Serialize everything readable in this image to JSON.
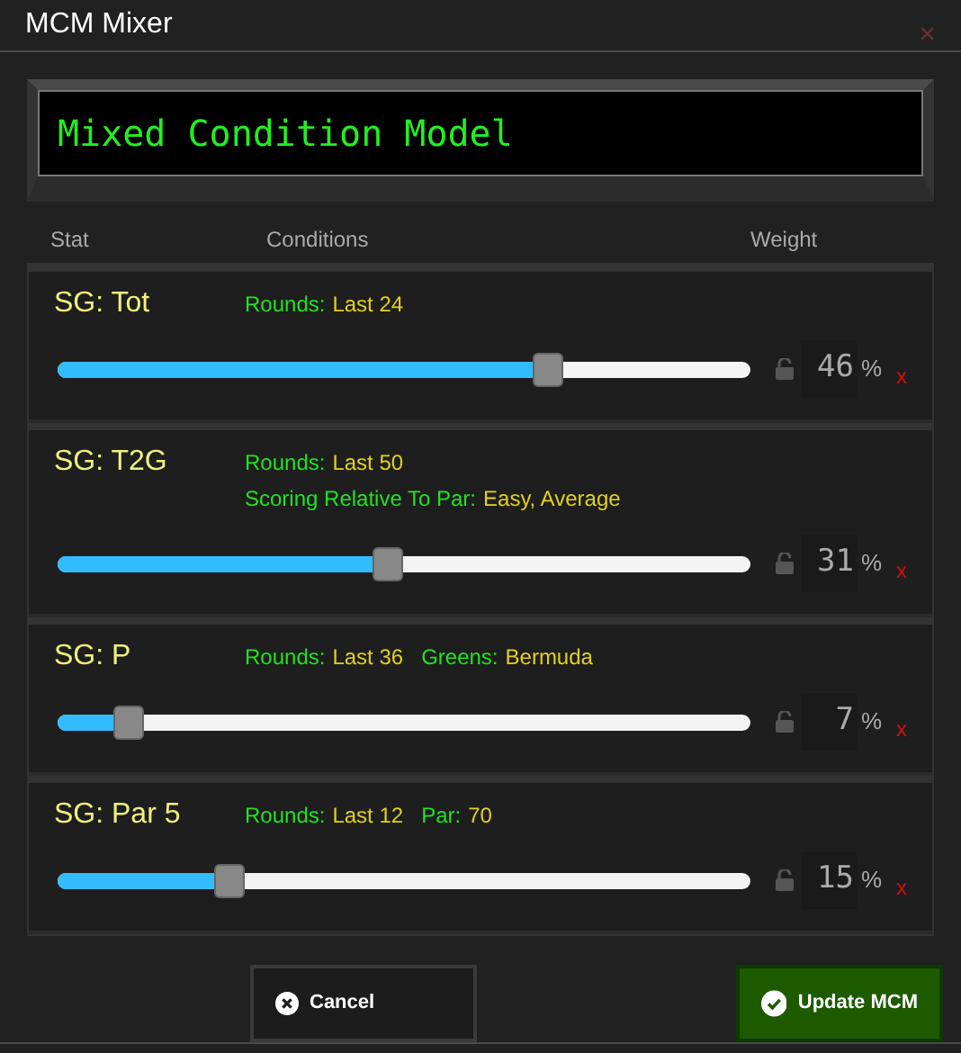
{
  "window": {
    "title": "MCM Mixer",
    "close": "×"
  },
  "display": {
    "text": "Mixed Condition Model"
  },
  "columns": [
    "Stat",
    "Conditions",
    "Weight"
  ],
  "rows": [
    {
      "stat": "SG: Tot",
      "conditions": [
        [
          {
            "label": "Rounds:",
            "value": "Last 24"
          }
        ]
      ],
      "level": 0.705,
      "weight": "46",
      "unit": "%",
      "remove": "x"
    },
    {
      "stat": "SG: T2G",
      "conditions": [
        [
          {
            "label": "Rounds:",
            "value": "Last 50"
          }
        ],
        [
          {
            "label": "Scoring Relative To Par:",
            "value": "Easy, Average"
          }
        ]
      ],
      "level": 0.476,
      "weight": "31",
      "unit": "%",
      "remove": "x"
    },
    {
      "stat": "SG: P",
      "conditions": [
        [
          {
            "label": "Rounds:",
            "value": "Last 36"
          },
          {
            "label": "Greens:",
            "value": "Bermuda"
          }
        ]
      ],
      "level": 0.1,
      "weight": "7",
      "unit": "%",
      "remove": "x"
    },
    {
      "stat": "SG: Par 5",
      "conditions": [
        [
          {
            "label": "Rounds:",
            "value": "Last 12"
          },
          {
            "label": "Par:",
            "value": "70"
          }
        ]
      ],
      "level": 0.247,
      "weight": "15",
      "unit": "%",
      "remove": "x"
    }
  ],
  "buttons": [
    {
      "label": "Cancel",
      "kind": "cancel"
    },
    {
      "label": "Update MCM",
      "kind": "confirm"
    }
  ]
}
